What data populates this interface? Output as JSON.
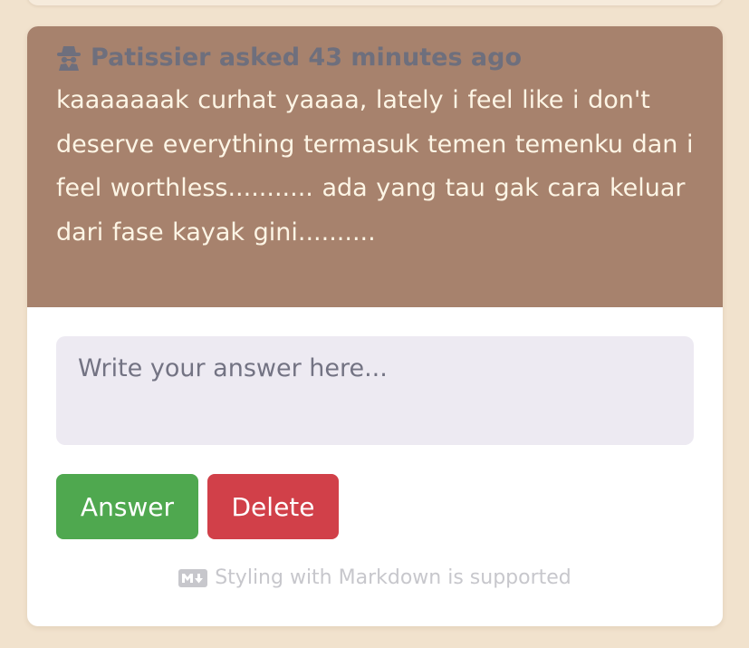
{
  "question": {
    "asker_line": "Patissier asked 43 minutes ago",
    "asker_icon": "spy-icon",
    "text": "kaaaaaaak curhat yaaaa, lately i feel like i don't deserve everything termasuk temen temenku dan i feel worthless........... ada yang tau gak cara keluar dari fase kayak gini.........."
  },
  "answer_form": {
    "placeholder": "Write your answer here...",
    "value": ""
  },
  "actions": {
    "answer_label": "Answer",
    "delete_label": "Delete"
  },
  "footer": {
    "markdown_icon": "markdown-icon",
    "markdown_note": "Styling with Markdown is supported"
  },
  "colors": {
    "page_background": "#f1e2cd",
    "header_background": "#a7826d",
    "question_text": "#fdf5e5",
    "asker_text": "#6e6f7d",
    "answer_button": "#4fa84f",
    "delete_button": "#d14049"
  }
}
